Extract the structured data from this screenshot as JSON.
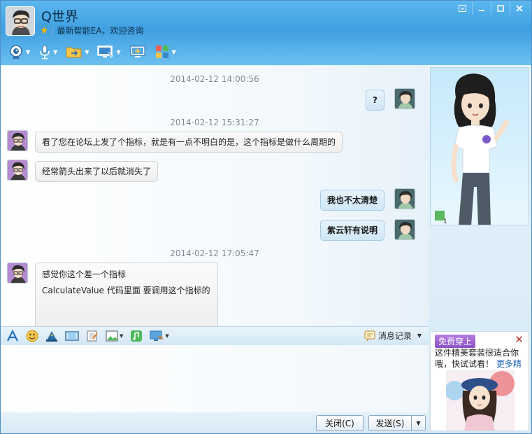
{
  "window": {
    "title": "Q世界",
    "status": "最新智能EA，欢迎咨询",
    "controls": {
      "menu": "▾",
      "minimize": "—",
      "maximize": "□",
      "close": "✕"
    }
  },
  "toolbar": {
    "items": [
      {
        "icon": "video-icon"
      },
      {
        "icon": "microphone-icon"
      },
      {
        "icon": "transfer-file-icon"
      },
      {
        "icon": "remote-desktop-icon"
      },
      {
        "icon": "share-screen-icon"
      },
      {
        "icon": "apps-icon"
      }
    ]
  },
  "chat": {
    "timestamps": [
      "2014-02-12 14:00:56",
      "2014-02-12 15:31:27",
      "2014-02-12 17:05:47"
    ],
    "messages": [
      {
        "side": "out",
        "text": "?"
      },
      {
        "side": "in",
        "text": "看了您在论坛上发了个指标，就是有一点不明白的是，这个指标是做什么周期的"
      },
      {
        "side": "in",
        "text": "经常箭头出来了以后就消失了"
      },
      {
        "side": "out",
        "text": "我也不太清楚"
      },
      {
        "side": "out",
        "text": "紫云轩有说明"
      },
      {
        "side": "in",
        "lines": [
          "感觉你这个差一个指标",
          "CalculateValue    代码里面 要调用这个指标的"
        ]
      }
    ]
  },
  "input_toolbar": {
    "history_label": "消息记录"
  },
  "buttons": {
    "close": "关闭(C)",
    "send": "发送(S)"
  },
  "show": {
    "badge": "1"
  },
  "ad": {
    "tag": "免费穿上",
    "text": "这件精美套装很适合你哦，快试试看！",
    "link": "更多精",
    "close": "✕"
  }
}
